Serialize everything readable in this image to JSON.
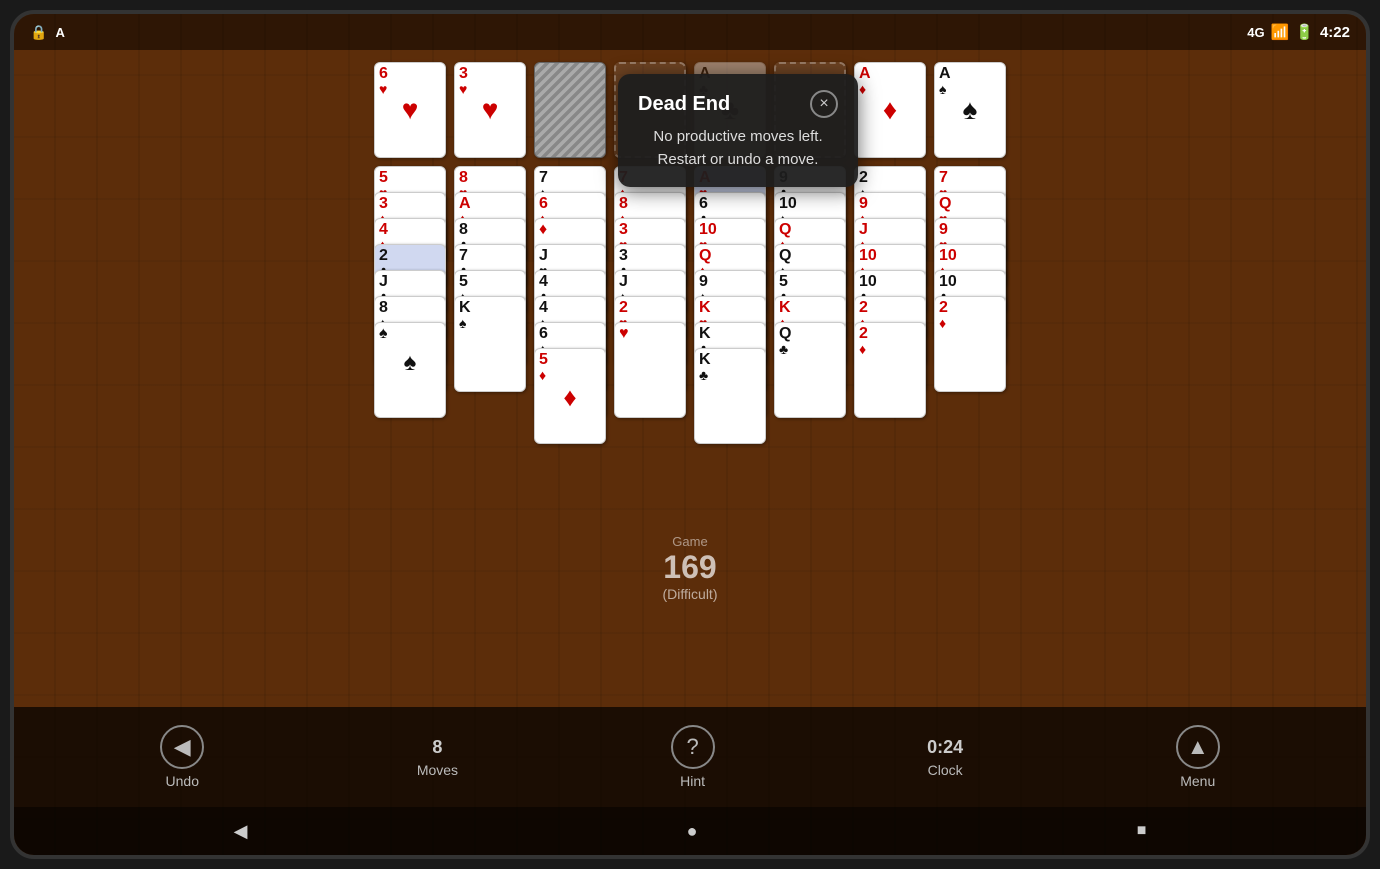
{
  "statusBar": {
    "time": "4:22",
    "icons": [
      "lock",
      "A"
    ]
  },
  "popup": {
    "title": "Dead End",
    "message_line1": "No productive moves left.",
    "message_line2": "Restart or undo a move.",
    "close_label": "×"
  },
  "foundation": [
    {
      "rank": "6",
      "suit": "♥",
      "color": "red"
    },
    {
      "rank": "3",
      "suit": "♥",
      "color": "red"
    },
    {
      "empty": true
    },
    {
      "empty": true
    },
    {
      "rank": "A",
      "suit": "♣",
      "color": "black",
      "dimmed": true
    },
    {
      "empty": true
    },
    {
      "rank": "A",
      "suit": "♦",
      "color": "red"
    },
    {
      "rank": "A",
      "suit": "♠",
      "color": "black"
    }
  ],
  "toolbar": {
    "undo_label": "Undo",
    "moves_label": "Moves",
    "moves_value": "8",
    "hint_label": "Hint",
    "clock_label": "Clock",
    "clock_value": "0:24",
    "menu_label": "Menu"
  },
  "score": {
    "game_label": "Game",
    "game_number": "169",
    "difficulty": "(Difficult)"
  },
  "nav": {
    "back": "◀",
    "home": "●",
    "recent": "■"
  }
}
